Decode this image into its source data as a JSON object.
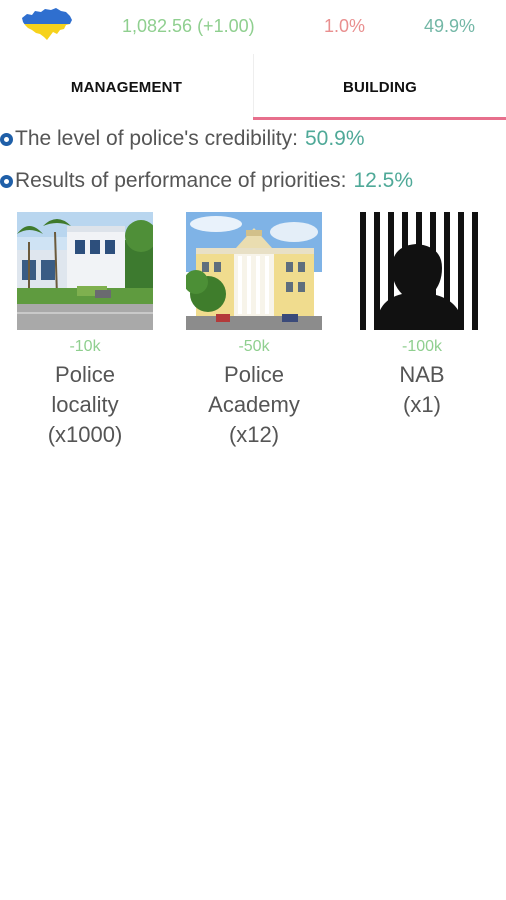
{
  "header": {
    "flag_icon": "ukraine-map-flag-icon",
    "colors": {
      "flag_blue": "#2f6fcf",
      "flag_yellow": "#f6d21c"
    },
    "money": "1,082.56 (+1.00)",
    "stat_red": "1.0%",
    "stat_green": "49.9%"
  },
  "tabs": {
    "management": "MANAGEMENT",
    "building": "BUILDING",
    "active": "building",
    "indicator_color": "#e76f8c"
  },
  "indicators": {
    "credibility_label": "The level of police's credibility:",
    "credibility_value": "50.9%",
    "priorities_label": "Results of performance of priorities:",
    "priorities_value": "12.5%"
  },
  "buildings": [
    {
      "cost": "-10k",
      "name_line1": "Police",
      "name_line2": "locality",
      "name_line3": "(x1000)",
      "image": "police-locality-photo"
    },
    {
      "cost": "-50k",
      "name_line1": "Police",
      "name_line2": "Academy",
      "name_line3": "(x12)",
      "image": "police-academy-photo"
    },
    {
      "cost": "-100k",
      "name_line1": "NAB",
      "name_line2": "(x1)",
      "name_line3": "",
      "image": "prisoner-behind-bars-image"
    }
  ]
}
